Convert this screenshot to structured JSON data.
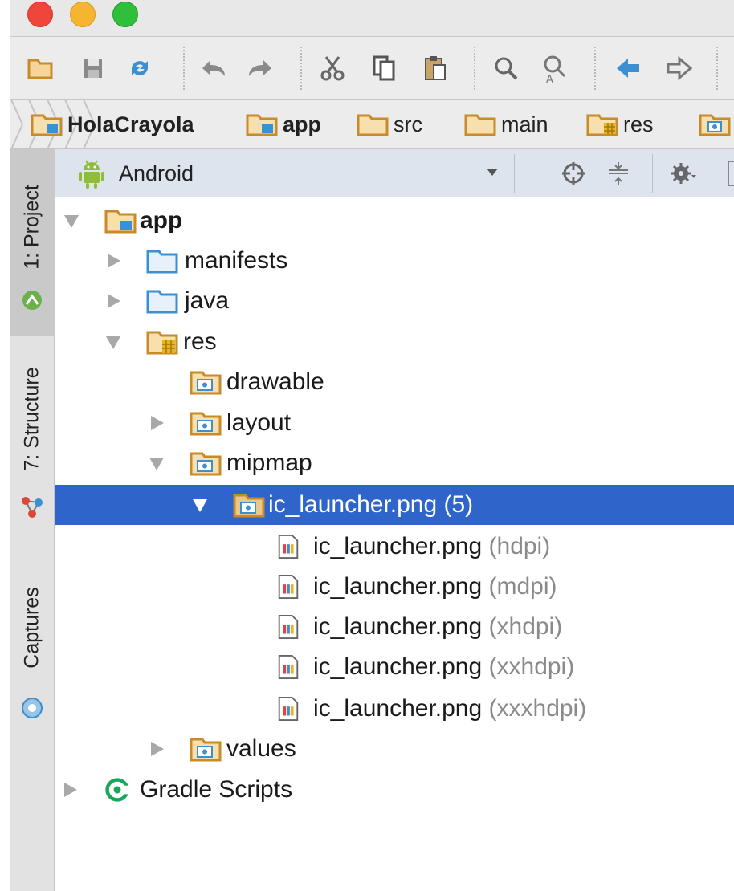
{
  "colors": {
    "selection": "#2f65ca",
    "folder_orange": "#c98a2a",
    "folder_blue": "#3c8fd0",
    "toolbar_bg": "#ececec",
    "header_bg": "#dde4ee",
    "android_green": "#8fbd3a",
    "gradle_green": "#1aa55a"
  },
  "toolbar": {
    "buttons": [
      "open-folder-icon",
      "save-icon",
      "sync-icon",
      "undo-icon",
      "redo-icon",
      "cut-icon",
      "copy-icon",
      "paste-icon",
      "find-icon",
      "replace-icon",
      "back-icon",
      "forward-icon"
    ]
  },
  "breadcrumb": [
    {
      "label": "HolaCrayola",
      "icon": "module-folder-icon"
    },
    {
      "label": "app",
      "icon": "module-folder-icon"
    },
    {
      "label": "src",
      "icon": "folder-icon"
    },
    {
      "label": "main",
      "icon": "folder-icon"
    },
    {
      "label": "res",
      "icon": "resource-folder-icon"
    },
    {
      "label": "",
      "icon": "resource-folder-icon"
    }
  ],
  "tool_windows": [
    {
      "label": "1: Project",
      "icon": "android-icon",
      "active": true
    },
    {
      "label": "7: Structure",
      "icon": "structure-icon",
      "active": false
    },
    {
      "label": "Captures",
      "icon": "captures-icon",
      "active": false
    }
  ],
  "project_panel": {
    "view_label": "Android",
    "header_icons": [
      "scroll-from-source-icon",
      "collapse-all-icon",
      "gear-icon"
    ]
  },
  "tree": [
    {
      "label": "app",
      "qualifier": "",
      "expanded": true,
      "selected": false,
      "icon": "module-folder-icon",
      "bold": true
    },
    {
      "label": "manifests",
      "qualifier": "",
      "expanded": false,
      "selected": false,
      "icon": "blue-folder-icon"
    },
    {
      "label": "java",
      "qualifier": "",
      "expanded": false,
      "selected": false,
      "icon": "blue-folder-icon"
    },
    {
      "label": "res",
      "qualifier": "",
      "expanded": true,
      "selected": false,
      "icon": "resource-folder-icon"
    },
    {
      "label": "drawable",
      "qualifier": "",
      "expanded": null,
      "selected": false,
      "icon": "res-folder-icon"
    },
    {
      "label": "layout",
      "qualifier": "",
      "expanded": false,
      "selected": false,
      "icon": "res-folder-icon"
    },
    {
      "label": "mipmap",
      "qualifier": "",
      "expanded": true,
      "selected": false,
      "icon": "res-folder-icon"
    },
    {
      "label": "ic_launcher.png (5)",
      "qualifier": "",
      "expanded": true,
      "selected": true,
      "icon": "res-folder-icon"
    },
    {
      "label": "ic_launcher.png",
      "qualifier": "(hdpi)",
      "expanded": null,
      "selected": false,
      "icon": "image-file-icon"
    },
    {
      "label": "ic_launcher.png",
      "qualifier": "(mdpi)",
      "expanded": null,
      "selected": false,
      "icon": "image-file-icon"
    },
    {
      "label": "ic_launcher.png",
      "qualifier": "(xhdpi)",
      "expanded": null,
      "selected": false,
      "icon": "image-file-icon"
    },
    {
      "label": "ic_launcher.png",
      "qualifier": "(xxhdpi)",
      "expanded": null,
      "selected": false,
      "icon": "image-file-icon"
    },
    {
      "label": "ic_launcher.png",
      "qualifier": "(xxxhdpi)",
      "expanded": null,
      "selected": false,
      "icon": "image-file-icon"
    },
    {
      "label": "values",
      "qualifier": "",
      "expanded": false,
      "selected": false,
      "icon": "res-folder-icon"
    },
    {
      "label": "Gradle Scripts",
      "qualifier": "",
      "expanded": false,
      "selected": false,
      "icon": "gradle-icon"
    }
  ]
}
